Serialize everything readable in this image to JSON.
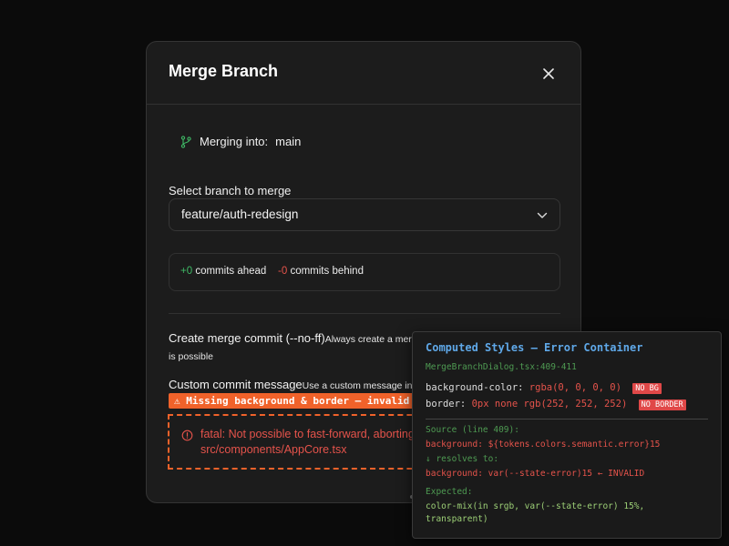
{
  "dialog": {
    "title": "Merge Branch",
    "merging_into_label": "Merging into:",
    "target_branch": "main",
    "select_label": "Select branch to merge",
    "selected_branch": "feature/auth-redesign",
    "commits": {
      "ahead_count": "+0",
      "ahead_label": "commits ahead",
      "behind_count": "-0",
      "behind_label": "commits behind"
    },
    "option_no_ff": {
      "title": "Create merge commit (--no-ff)",
      "description": "Always create a merge c",
      "description_cont": "is possible"
    },
    "option_custom": {
      "title": "Custom commit message",
      "description": "Use a custom message instea"
    },
    "warning_badge": "⚠ Missing background & border — invalid",
    "error": {
      "line1": "fatal: Not possible to fast-forward, aborting.",
      "line2": "src/components/AppCore.tsx"
    }
  },
  "inspector": {
    "title": "Computed Styles — Error Container",
    "file": "MergeBranchDialog.tsx:409-411",
    "bg_prop": "background-color:",
    "bg_value": "rgba(0, 0, 0, 0)",
    "bg_tag": "NO BG",
    "border_prop": "border:",
    "border_value": "0px none rgb(252, 252, 252)",
    "border_tag": "NO BORDER",
    "source_label": "Source (line 409):",
    "source_code": "background: ${tokens.colors.semantic.error}15",
    "resolves_label": "↓ resolves to:",
    "resolved_code": "background: var(--state-error)15 ← INVALID",
    "expected_label": "Expected:",
    "expected_line1": "color-mix(in srgb, var(--state-error) 15%,",
    "expected_line2": "transparent)"
  },
  "colors": {
    "accent_orange": "#f0622a",
    "success_green": "#3fb966",
    "error_red": "#e5534b",
    "inspector_title_blue": "#5fa8e8"
  },
  "icons": [
    "close-icon",
    "git-branch-icon",
    "chevron-down-icon",
    "alert-circle-icon"
  ]
}
